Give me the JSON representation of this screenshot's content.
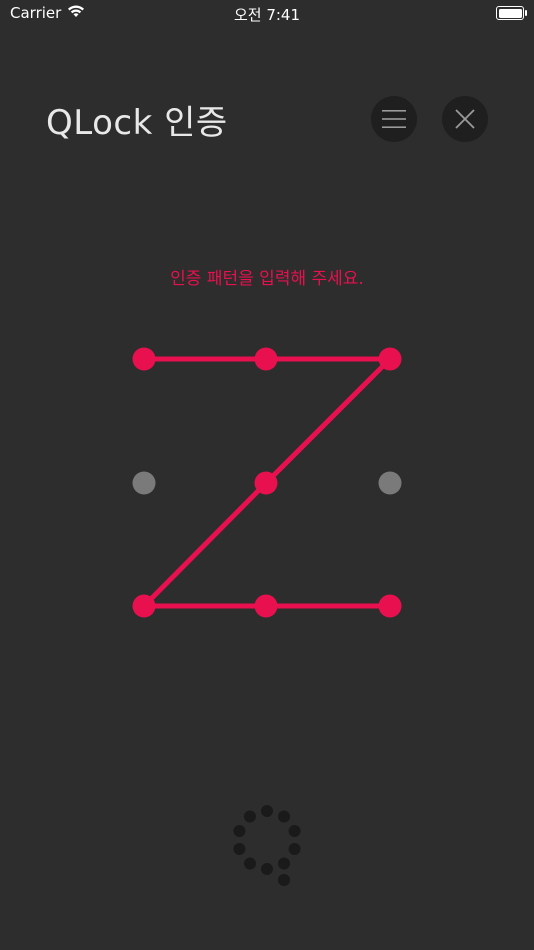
{
  "status": {
    "carrier": "Carrier",
    "time": "오전 7:41"
  },
  "header": {
    "title": "QLock 인증"
  },
  "instruction": {
    "text": "인증 패턴을 입력해 주세요."
  },
  "pattern": {
    "grid": [
      {
        "id": 1,
        "active": true
      },
      {
        "id": 2,
        "active": true
      },
      {
        "id": 3,
        "active": true
      },
      {
        "id": 4,
        "active": false
      },
      {
        "id": 5,
        "active": true
      },
      {
        "id": 6,
        "active": false
      },
      {
        "id": 7,
        "active": true
      },
      {
        "id": 8,
        "active": true
      },
      {
        "id": 9,
        "active": true
      }
    ],
    "path": [
      1,
      2,
      3,
      5,
      7,
      8,
      9
    ]
  },
  "colors": {
    "accent": "#e8104e",
    "inactive_dot": "#7a7a7a",
    "background": "#2d2d2d",
    "button_bg": "#1f1f1f",
    "loader_dot": "#1a1a1a"
  },
  "icons": {
    "menu": "hamburger-icon",
    "close": "close-icon",
    "wifi": "wifi-icon",
    "battery": "battery-icon",
    "logo": "q-logo-icon"
  }
}
